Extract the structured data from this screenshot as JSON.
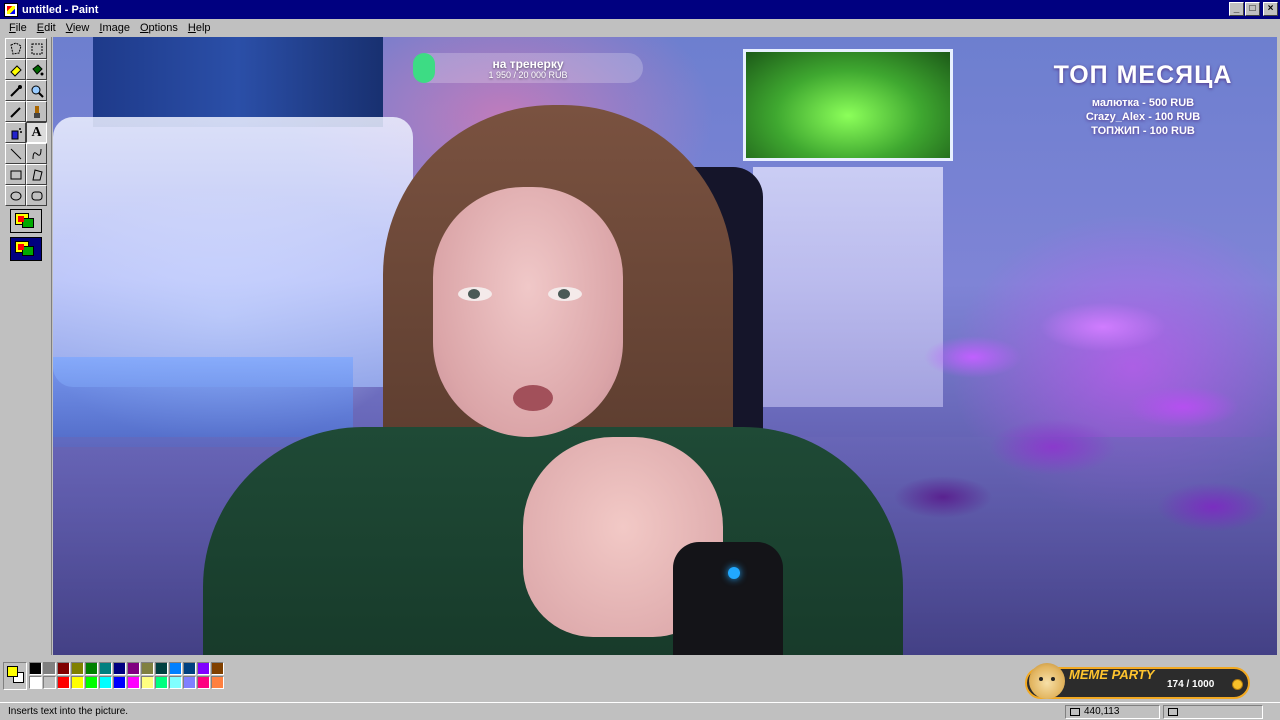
{
  "window": {
    "title": "untitled - Paint",
    "minimize": "_",
    "maximize": "□",
    "close": "×"
  },
  "menu": [
    {
      "key": "F",
      "rest": "ile"
    },
    {
      "key": "E",
      "rest": "dit"
    },
    {
      "key": "V",
      "rest": "iew"
    },
    {
      "key": "I",
      "rest": "mage"
    },
    {
      "key": "O",
      "rest": "ptions"
    },
    {
      "key": "H",
      "rest": "elp"
    }
  ],
  "toolbox": {
    "tools": [
      "free-select",
      "select",
      "eraser",
      "fill",
      "pick-color",
      "magnifier",
      "pencil",
      "brush",
      "airbrush",
      "text",
      "line",
      "curve",
      "rectangle",
      "polygon",
      "ellipse",
      "rounded-rectangle"
    ],
    "active_tool": "text",
    "text_glyph": "A"
  },
  "stream_overlay": {
    "goal": {
      "title": "на тренерку",
      "amount": "1 950 / 20 000 RUB",
      "progress_fraction": 0.0975
    },
    "top_month": {
      "title": "ТОП МЕСЯЦА",
      "items": [
        "малютка - 500 RUB",
        "Crazy_Alex - 100 RUB",
        "ТОПЖИП - 100 RUB"
      ]
    },
    "meme_party": {
      "label": "MEME PARTY",
      "count": "174 / 1000"
    }
  },
  "palette": {
    "foreground": "#ffff00",
    "background": "#ffffff",
    "colors": [
      "#000000",
      "#808080",
      "#800000",
      "#808000",
      "#008000",
      "#008080",
      "#000080",
      "#800080",
      "#808040",
      "#004040",
      "#0080ff",
      "#004080",
      "#8000ff",
      "#804000",
      "#ffffff",
      "#c0c0c0",
      "#ff0000",
      "#ffff00",
      "#00ff00",
      "#00ffff",
      "#0000ff",
      "#ff00ff",
      "#ffff80",
      "#00ff80",
      "#80ffff",
      "#8080ff",
      "#ff0080",
      "#ff8040"
    ]
  },
  "statusbar": {
    "text": "Inserts text into the picture.",
    "coords": "440,113",
    "size": ""
  }
}
